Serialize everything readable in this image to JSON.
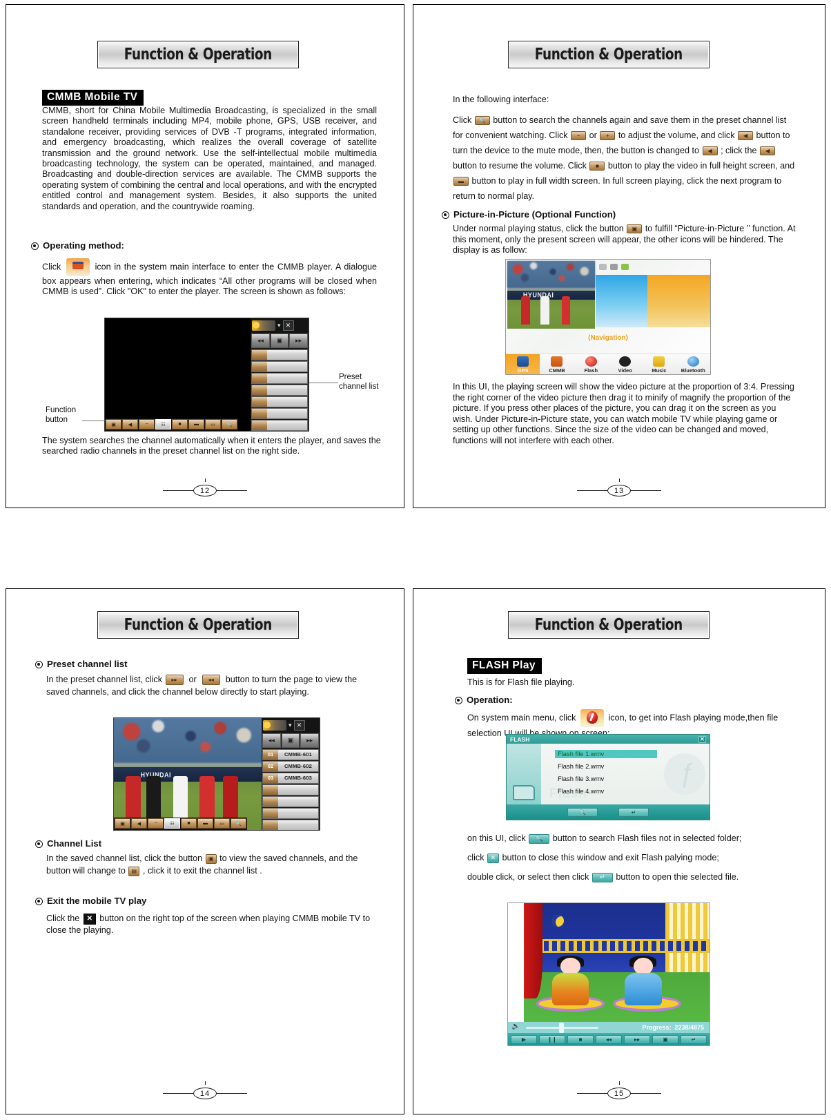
{
  "pages": [
    {
      "banner": "Function & Operation",
      "number": "12",
      "section_label": "CMMB Mobile TV",
      "intro": "CMMB, short for China Mobile Multimedia Broadcasting, is specialized in the small screen handheld terminals including MP4, mobile phone, GPS, USB receiver, and standalone receiver, providing services of DVB -T programs, integrated information, and emergency broadcasting, which realizes the overall coverage of satellite transmission and the ground network. Use the self-intellectual mobile multimedia broadcasting technology, the system can be operated, maintained, and managed. Broadcasting and double-direction services are available. The CMMB supports the operating system of combining the central and local operations, and with the encrypted entitled control and management system. Besides, it also supports the united standards and operation, and the countrywide roaming.",
      "operating_method_title": "Operating method:",
      "operating_method_pre": "Click",
      "operating_method_post": "icon in the system main interface to enter the CMMB player. A dialogue box appears when entering, which indicates “All other programs will be closed when CMMB is used”. Click \"OK\" to enter the player. The screen is shown as follows:",
      "callout_preset": "Preset\nchannel list",
      "callout_function": "Function\nbutton",
      "closing": "The system searches the channel automatically when it enters the player, and saves the searched radio channels in the preset channel list on the right side."
    },
    {
      "banner": "Function & Operation",
      "number": "13",
      "lead": "In the following interface:",
      "para1_a": "Click",
      "para1_b": "button to search the channels again and save them in the preset channel list for convenient watching. Click",
      "para1_c": "or",
      "para1_d": "to adjust the volume, and click",
      "para1_e": "button to turn the device to the mute mode, then, the button is changed to",
      "para1_f": "; click the",
      "para1_g": "button to resume the volume. Click",
      "para1_h": "button to play the video in full height screen, and",
      "para1_i": "button to play in full width screen. In full screen playing, click the next program to return to normal play.",
      "pip_title": "Picture-in-Picture (Optional Function)",
      "pip_a": "Under normal playing status, click the button",
      "pip_b": "to fulfill “Picture-in-Picture ’’ function. At this moment, only the present screen will appear, the other icons will be hindered. The display is as follow:",
      "pip_closing": "In this UI, the playing screen will show the video picture at the proportion of 3:4. Pressing the right corner of the video picture then drag it to minify of magnify the proportion of the picture. If you press other places of the picture, you can drag it on the screen as you wish. Under Picture-in-Picture state, you can watch mobile TV while playing game or setting up other functions. Since the size of the video can be changed and moved, functions will not interfere with each other.",
      "dock": [
        {
          "label": "GPS",
          "active": true
        },
        {
          "label": "CMMB",
          "active": false
        },
        {
          "label": "Flash",
          "active": false
        },
        {
          "label": "Video",
          "active": false
        },
        {
          "label": "Music",
          "active": false
        },
        {
          "label": "Bluetooth",
          "active": false
        }
      ],
      "nav_watermark": "(Navigation)"
    },
    {
      "banner": "Function & Operation",
      "number": "14",
      "preset_title": "Preset channel list",
      "preset_a": "In the preset channel list, click",
      "preset_b": "or",
      "preset_c": "button to turn the page to view the saved channels, and click the channel below directly to start playing.",
      "channel_list_title": "Channel List",
      "channel_a": "In the saved channel list, click the button",
      "channel_b": "to view the saved channels, and the button will change to",
      "channel_c": ", click it to exit the channel list .",
      "exit_title": "Exit the mobile TV play",
      "exit_a": "Click the",
      "exit_b": "button on the right top of the screen when playing CMMB mobile TV to close the playing.",
      "channels": [
        {
          "num": "01",
          "name": "CMMB-601"
        },
        {
          "num": "02",
          "name": "CMMB-602"
        },
        {
          "num": "03",
          "name": "CMMB-603"
        }
      ],
      "scoreboard": "HYUNDAI"
    },
    {
      "banner": "Function & Operation",
      "number": "15",
      "section_label": "FLASH Play",
      "intro": "This is for Flash file playing.",
      "operation_title": "Operation:",
      "operation_a": "On system main menu, click",
      "operation_b": "icon, to get into Flash playing mode,then file selection UI will be shown on screen:",
      "fsel_title": "FLASH",
      "files": [
        "Flash file 1.wmv",
        "Flash file 2.wmv",
        "Flash file 3.wmv",
        "Flash file 4.wmv"
      ],
      "fsel_watermark": "Flash",
      "after_a": "on this UI, click",
      "after_b": "button to search Flash files not in selected folder;",
      "after_c": "click",
      "after_d": "button to close this window and exit Flash palying mode;",
      "after_e": "double click, or select then click",
      "after_f": "button to open thie selected file.",
      "progress_label": "Progress:",
      "progress_value": "2238/4875"
    }
  ]
}
